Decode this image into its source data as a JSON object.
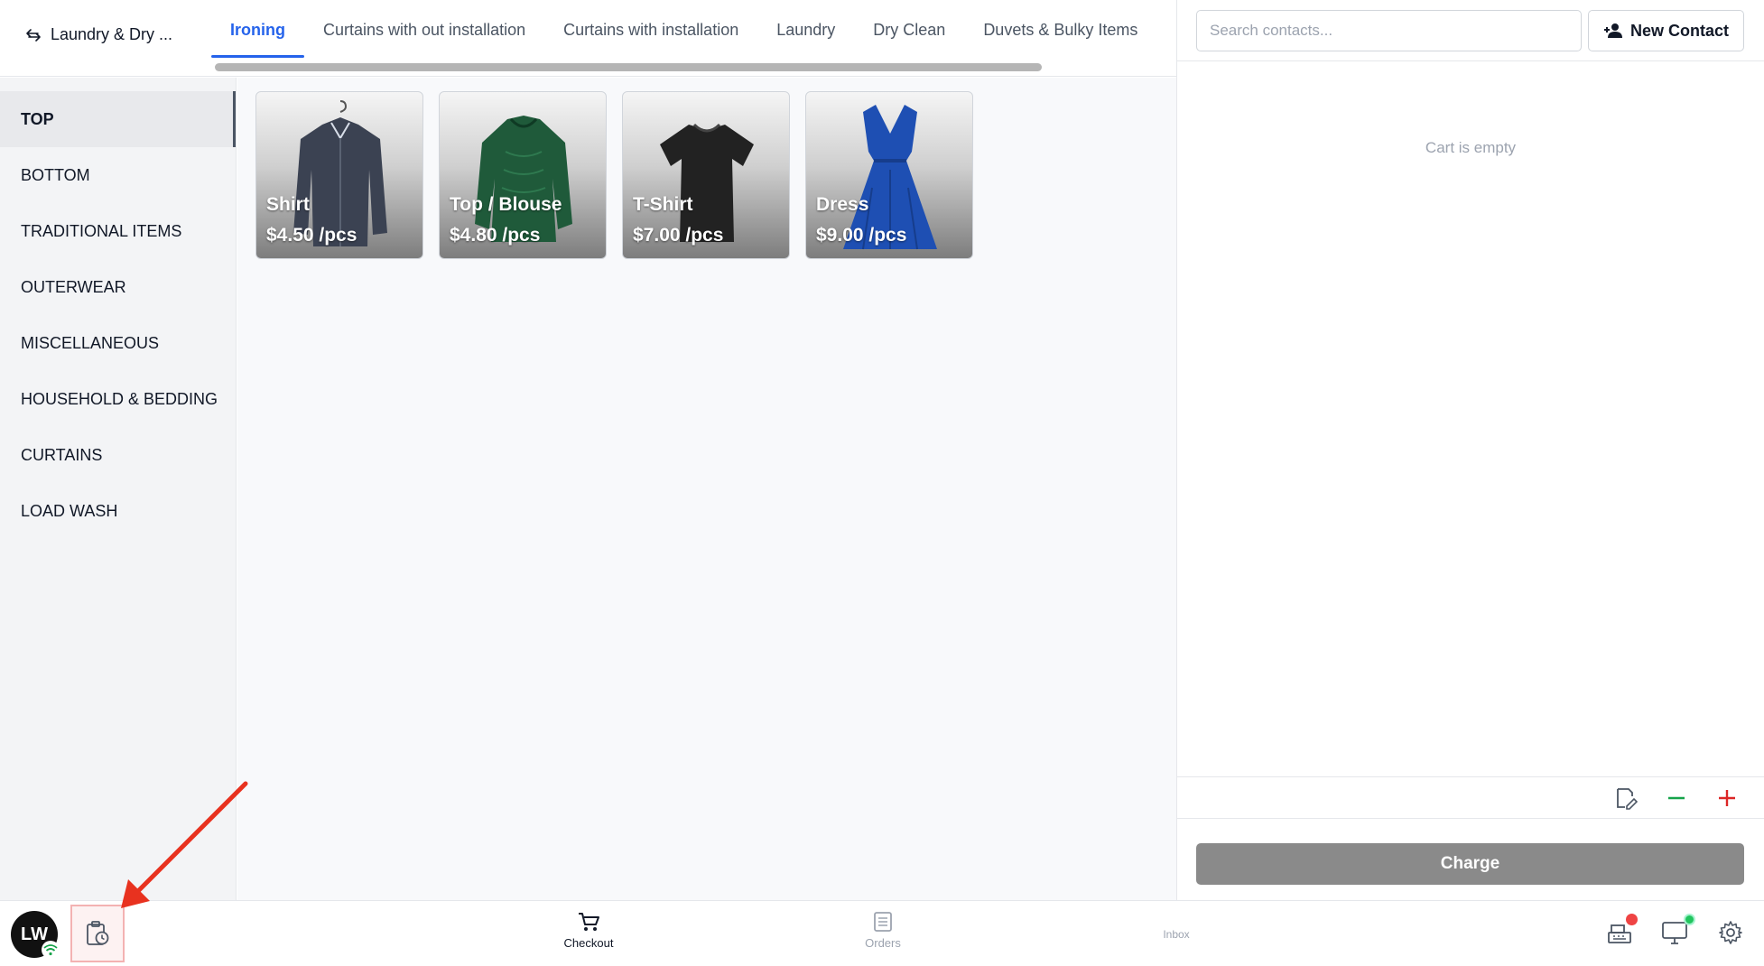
{
  "header": {
    "store_name": "Laundry & Dry ...",
    "tabs": [
      {
        "label": "Ironing",
        "active": true
      },
      {
        "label": "Curtains with out installation",
        "active": false
      },
      {
        "label": "Curtains with installation",
        "active": false
      },
      {
        "label": "Laundry",
        "active": false
      },
      {
        "label": "Dry Clean",
        "active": false
      },
      {
        "label": "Duvets & Bulky Items",
        "active": false
      }
    ]
  },
  "categories": [
    {
      "label": "TOP",
      "active": true
    },
    {
      "label": "BOTTOM",
      "active": false
    },
    {
      "label": "TRADITIONAL ITEMS",
      "active": false
    },
    {
      "label": "OUTERWEAR",
      "active": false
    },
    {
      "label": "MISCELLANEOUS",
      "active": false
    },
    {
      "label": "HOUSEHOLD & BEDDING",
      "active": false
    },
    {
      "label": "CURTAINS",
      "active": false
    },
    {
      "label": "LOAD WASH",
      "active": false
    }
  ],
  "products": [
    {
      "name": "Shirt",
      "price": "$4.50 /pcs",
      "icon": "shirt-icon",
      "color": "#3b4252"
    },
    {
      "name": "Top / Blouse",
      "price": "$4.80 /pcs",
      "icon": "blouse-icon",
      "color": "#1f5a3a"
    },
    {
      "name": "T-Shirt",
      "price": "$7.00 /pcs",
      "icon": "tshirt-icon",
      "color": "#222222"
    },
    {
      "name": "Dress",
      "price": "$9.00 /pcs",
      "icon": "dress-icon",
      "color": "#1e4fb3"
    }
  ],
  "cart": {
    "search_placeholder": "Search contacts...",
    "new_contact_label": "New Contact",
    "empty_text": "Cart is empty",
    "charge_label": "Charge"
  },
  "bottom_nav": {
    "avatar_initials": "LW",
    "items": [
      {
        "label": "Checkout",
        "active": true
      },
      {
        "label": "Orders",
        "active": false
      },
      {
        "label": "Inbox",
        "active": false
      }
    ]
  },
  "colors": {
    "accent": "#2563eb",
    "charge_bg": "#8a8a8a",
    "minus": "#16a34a",
    "plus": "#dc2626",
    "annotation": "#e8321f"
  }
}
